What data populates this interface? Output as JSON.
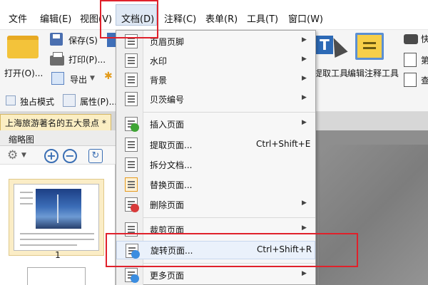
{
  "menubar": {
    "items": [
      "文件",
      "编辑(E)",
      "视图(V)",
      "文档(D)",
      "注释(C)",
      "表单(R)",
      "工具(T)",
      "窗口(W)"
    ]
  },
  "ribbon": {
    "open": "打开(O)...",
    "save": "保存(S)",
    "print": "打印(P)...",
    "export": "导出",
    "exclusive_mode": "独占模式",
    "properties": "属性(P)...",
    "extract_tool": "提取工具",
    "edit_comment_tool": "编辑注释工具",
    "right_clip_1": "快",
    "right_clip_2": "第",
    "right_clip_3": "查"
  },
  "document_tab": {
    "title": "上海旅游著名的五大景点 *"
  },
  "thumbnail_panel": {
    "title": "缩略图",
    "page_number": "1"
  },
  "document_menu": {
    "items": [
      {
        "label": "页眉页脚",
        "shortcut": "",
        "submenu": true
      },
      {
        "label": "水印",
        "shortcut": "",
        "submenu": true
      },
      {
        "label": "背景",
        "shortcut": "",
        "submenu": true
      },
      {
        "label": "贝茨编号",
        "shortcut": "",
        "submenu": true
      },
      {
        "label": "插入页面",
        "shortcut": "",
        "submenu": true
      },
      {
        "label": "提取页面...",
        "shortcut": "Ctrl+Shift+E",
        "submenu": false
      },
      {
        "label": "拆分文档...",
        "shortcut": "",
        "submenu": false
      },
      {
        "label": "替换页面...",
        "shortcut": "",
        "submenu": false
      },
      {
        "label": "删除页面",
        "shortcut": "",
        "submenu": true
      },
      {
        "label": "裁剪页面",
        "shortcut": "",
        "submenu": true
      },
      {
        "label": "旋转页面...",
        "shortcut": "Ctrl+Shift+R",
        "submenu": false
      },
      {
        "label": "更多页面",
        "shortcut": "",
        "submenu": true
      }
    ]
  },
  "colors": {
    "highlight_red": "#e0212b",
    "accent_blue": "#3b6fb4",
    "tab_yellow": "#fbeec3"
  }
}
